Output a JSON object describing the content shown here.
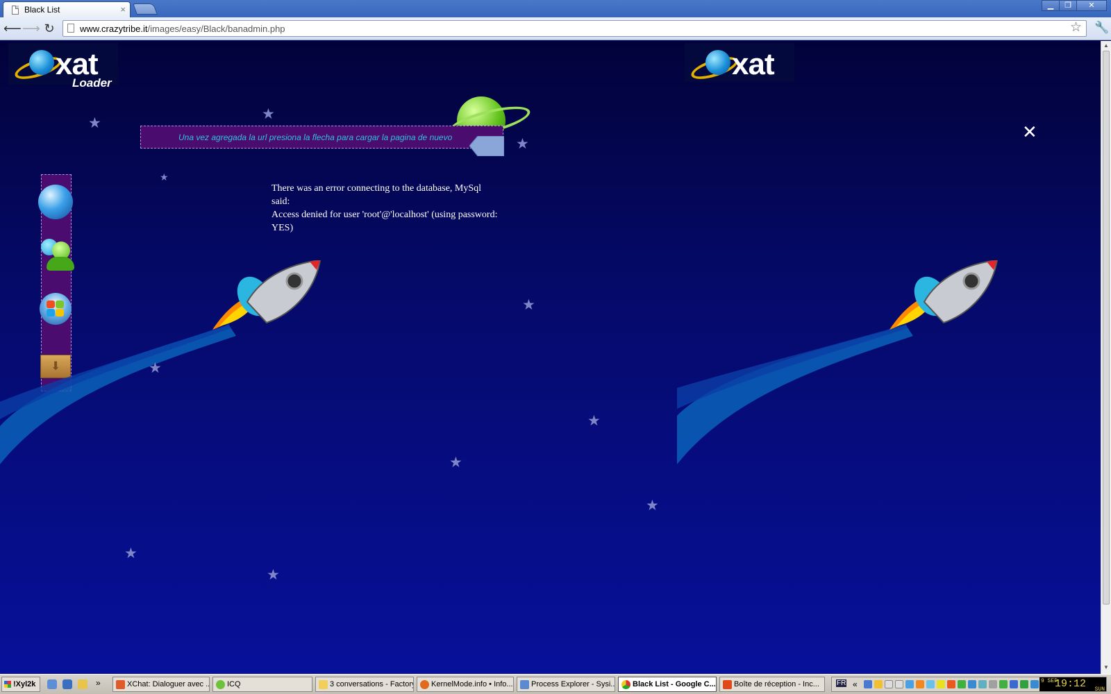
{
  "browser": {
    "tab_title": "Black List",
    "tab_close": "×",
    "url_host": "www.crazytribe.it",
    "url_path": "/images/easy/Black/banadmin.php"
  },
  "page": {
    "logo_text": "xat",
    "logo_sub": "Loader",
    "logo2_text": "xat",
    "banner_text": "Una vez agregada la url presiona la flecha para cargar la pagina de nuevo",
    "error_lines": [
      "There was an error connecting to the database, MySql said:",
      "Access denied for user 'root'@'localhost' (using password: YES)"
    ],
    "colors": {
      "background": "#050a6a",
      "panel": "#4a0c6e",
      "banner_text": "#30c0e0"
    },
    "dock_icons": [
      "globe-icon",
      "messenger-icon",
      "windows-icon",
      "box-icon"
    ]
  },
  "taskbar": {
    "start_label": "!Xyl2k",
    "chevron": "»",
    "tasks": [
      {
        "label": "XChat: Dialoguer avec ..."
      },
      {
        "label": "ICQ"
      },
      {
        "label": "3 conversations - Factory"
      },
      {
        "label": "KernelMode.info • Info..."
      },
      {
        "label": "Process Explorer - Sysi..."
      },
      {
        "label": "Black List - Google C..."
      },
      {
        "label": "Boîte de réception - Inc..."
      }
    ],
    "tray_lang": "FR",
    "tray_chevron": "«",
    "clock_time": "19:12",
    "clock_date": "9 SEP",
    "clock_day": "SUN"
  }
}
